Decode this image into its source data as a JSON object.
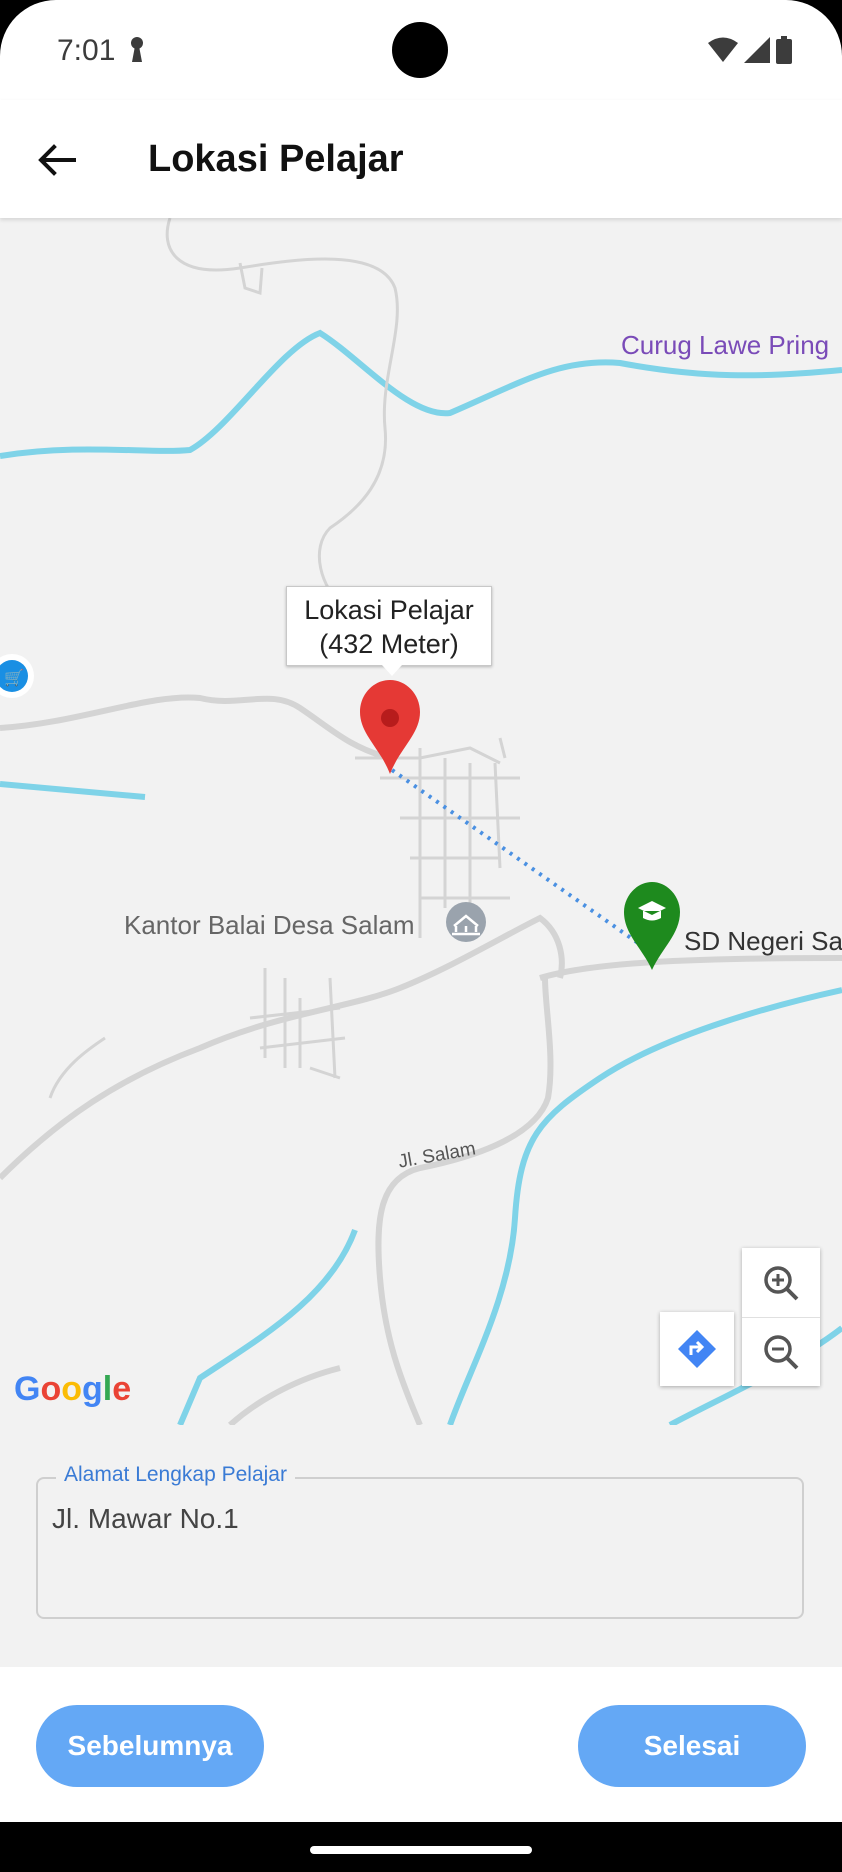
{
  "status_bar": {
    "time": "7:01"
  },
  "app_bar": {
    "title": "Lokasi Pelajar"
  },
  "map": {
    "labels": {
      "waterfall": "Curug Lawe Pring",
      "village_office": "Kantor Balai Desa Salam",
      "school": "SD Negeri Sa",
      "road": "Jl. Salam"
    },
    "info_window": {
      "line1": "Lokasi Pelajar",
      "line2": "(432 Meter)"
    },
    "attribution": "Google",
    "colors": {
      "route": "#4a90e2",
      "student_pin": "#e53935",
      "school_pin": "#1e8a1e",
      "river": "#7fd3e8"
    }
  },
  "address": {
    "label": "Alamat Lengkap Pelajar",
    "value": "Jl. Mawar No.1"
  },
  "buttons": {
    "previous": "Sebelumnya",
    "finish": "Selesai"
  },
  "colors": {
    "primary_button": "#64a8f5"
  }
}
